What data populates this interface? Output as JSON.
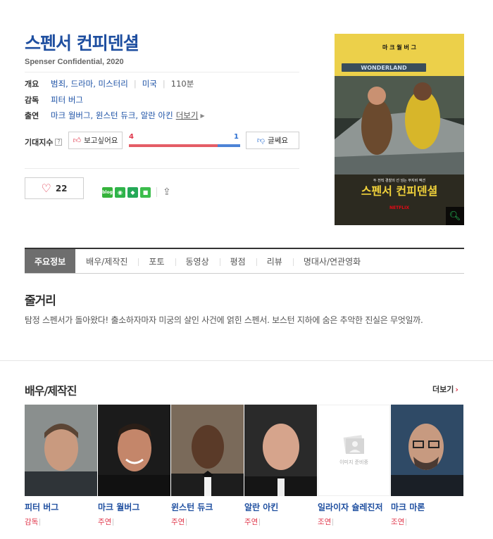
{
  "movie": {
    "title": "스펜서 컨피덴셜",
    "subtitle": "Spenser Confidential, 2020"
  },
  "info": {
    "overview_label": "개요",
    "genres": "범죄, 드라마, 미스터리",
    "country": "미국",
    "runtime": "110분",
    "director_label": "감독",
    "director": "피터 버그",
    "cast_label": "출연",
    "cast": "마크 월버그, 윈스턴 듀크, 알란 아킨",
    "more": "더보기"
  },
  "expectation": {
    "label": "기대지수",
    "help": "?",
    "like_label": "보고싶어요",
    "dislike_label": "글쎄요",
    "like_count": "4",
    "dislike_count": "1",
    "like_ratio": 0.8
  },
  "actions": {
    "heart_count": "22",
    "share_blog": "blog"
  },
  "poster": {
    "top_names": "마 크   월 버 그",
    "tagline": "두 전직 경찰의 선 넘는 무지비 액션",
    "title": "스펜서 컨피덴셜",
    "sign": "WONDERLAND",
    "brand": "NETFLIX"
  },
  "tabs": [
    "주요정보",
    "배우/제작진",
    "포토",
    "동영상",
    "평점",
    "리뷰",
    "명대사/연관영화"
  ],
  "synopsis": {
    "heading": "줄거리",
    "text": "탐정 스펜서가 돌아왔다! 출소하자마자 미궁의 살인 사건에 얽힌 스펜서. 보스턴 지하에 숨은 추악한 진실은 무엇일까."
  },
  "cast_section": {
    "heading": "배우/제작진",
    "more": "더보기",
    "noimg_text": "이미지 준비중",
    "people": [
      {
        "name": "피터 버그",
        "role": "감독"
      },
      {
        "name": "마크 월버그",
        "role": "주연"
      },
      {
        "name": "윈스턴 듀크",
        "role": "주연"
      },
      {
        "name": "알란 아킨",
        "role": "주연"
      },
      {
        "name": "일라이자 슐레진저",
        "role": "조연"
      },
      {
        "name": "마크 마론",
        "role": "조연"
      }
    ]
  }
}
